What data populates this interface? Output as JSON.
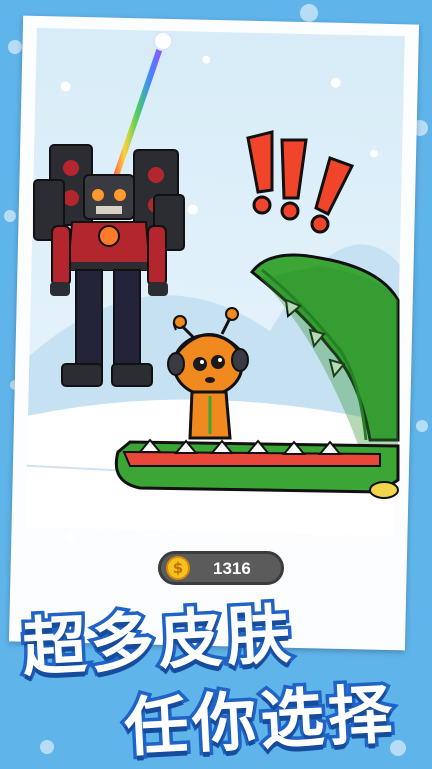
{
  "coins": {
    "icon": "dollar-coin-icon",
    "symbol": "$",
    "count": "1316"
  },
  "promo": {
    "line1": "超多皮肤",
    "line2": "任你选择"
  },
  "scene": {
    "alert_icon": "exclamation-marks",
    "characters": [
      "speaker-robot-enemy",
      "orange-headphone-hero",
      "green-crocodile"
    ],
    "rope": "rainbow-rope"
  },
  "colors": {
    "background": "#5fb4ea",
    "promo_text": "#ffffff",
    "promo_outline": "#1f63c6",
    "exclamation": "#f0452a",
    "crocodile": "#3ba536",
    "hero": "#f08a1f",
    "robot_suit": "#b3262e"
  }
}
